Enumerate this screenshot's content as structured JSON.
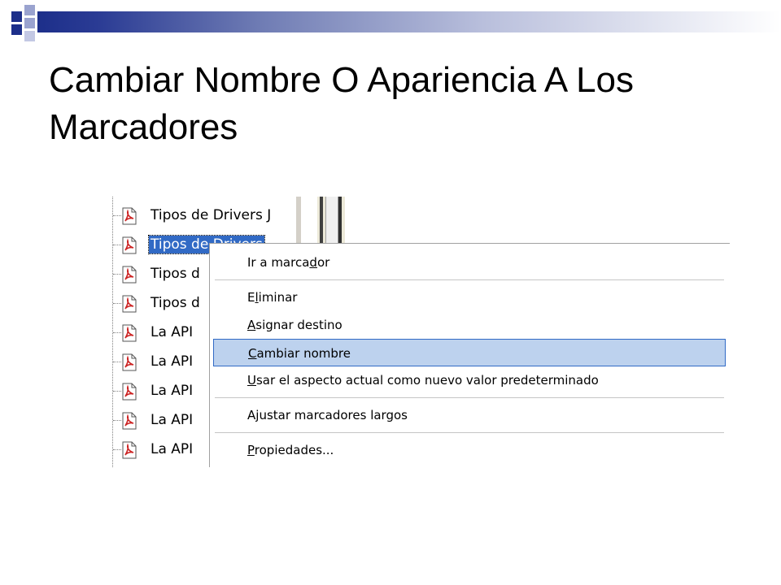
{
  "slide": {
    "title": "Cambiar Nombre O Apariencia A Los Marcadores"
  },
  "colors": {
    "accent_blue": "#1d2f8a",
    "light_blue": "#8a94c6",
    "selection_blue": "#316ac5",
    "menu_highlight": "#bdd2ee",
    "pdf_red": "#cc2222"
  },
  "bookmarks": {
    "items": [
      {
        "label": "Tipos de Drivers J",
        "icon": "pdf-bookmark-icon",
        "selected": false
      },
      {
        "label": "Tipos de Drivers",
        "icon": "pdf-bookmark-icon",
        "selected": true
      },
      {
        "label": "Tipos d",
        "icon": "pdf-bookmark-icon",
        "selected": false
      },
      {
        "label": "Tipos d",
        "icon": "pdf-bookmark-icon",
        "selected": false
      },
      {
        "label": "La API",
        "icon": "pdf-bookmark-icon",
        "selected": false
      },
      {
        "label": "La API",
        "icon": "pdf-bookmark-icon",
        "selected": false
      },
      {
        "label": "La API",
        "icon": "pdf-bookmark-icon",
        "selected": false
      },
      {
        "label": "La API",
        "icon": "pdf-bookmark-icon",
        "selected": false
      },
      {
        "label": "La API",
        "icon": "pdf-bookmark-icon",
        "selected": false
      }
    ]
  },
  "context_menu": {
    "items": [
      {
        "pre": "Ir a marca",
        "acc": "d",
        "post": "or",
        "highlighted": false
      },
      {
        "pre": "E",
        "acc": "l",
        "post": "iminar",
        "highlighted": false
      },
      {
        "pre": "",
        "acc": "A",
        "post": "signar destino",
        "highlighted": false
      },
      {
        "pre": "",
        "acc": "C",
        "post": "ambiar nombre",
        "highlighted": true
      },
      {
        "pre": "",
        "acc": "U",
        "post": "sar el aspecto actual como nuevo valor predeterminado",
        "highlighted": false
      },
      {
        "pre": "A",
        "acc": "j",
        "post": "ustar marcadores largos",
        "highlighted": false
      },
      {
        "pre": "",
        "acc": "P",
        "post": "ropiedades...",
        "highlighted": false
      }
    ]
  }
}
